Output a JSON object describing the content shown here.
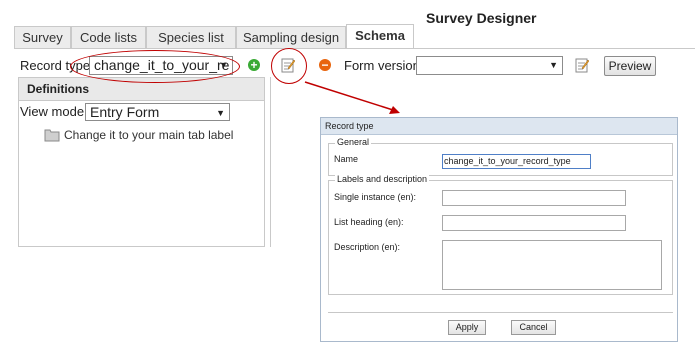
{
  "app": {
    "title": "Survey Designer"
  },
  "tabs": [
    {
      "label": "Survey"
    },
    {
      "label": "Code lists"
    },
    {
      "label": "Species list"
    },
    {
      "label": "Sampling design"
    },
    {
      "label": "Schema"
    }
  ],
  "toolbar": {
    "record_type_label": "Record type:",
    "record_type_value": "change_it_to_your_re",
    "form_version_label": "Form version:",
    "form_version_value": "",
    "preview_label": "Preview"
  },
  "definitions": {
    "header": "Definitions",
    "view_mode_label": "View mode:",
    "view_mode_value": "Entry Form",
    "tree_item": "Change it to your main tab label"
  },
  "dialog": {
    "title": "Record type",
    "general_legend": "General",
    "name_label": "Name",
    "name_value": "change_it_to_your_record_type",
    "labels_legend": "Labels and description",
    "single_instance_label": "Single instance (en):",
    "list_heading_label": "List heading (en):",
    "description_label": "Description (en):",
    "apply_label": "Apply",
    "cancel_label": "Cancel"
  },
  "colors": {
    "annotation": "#c00000",
    "add": "#3aaa35",
    "remove": "#e8650e"
  }
}
